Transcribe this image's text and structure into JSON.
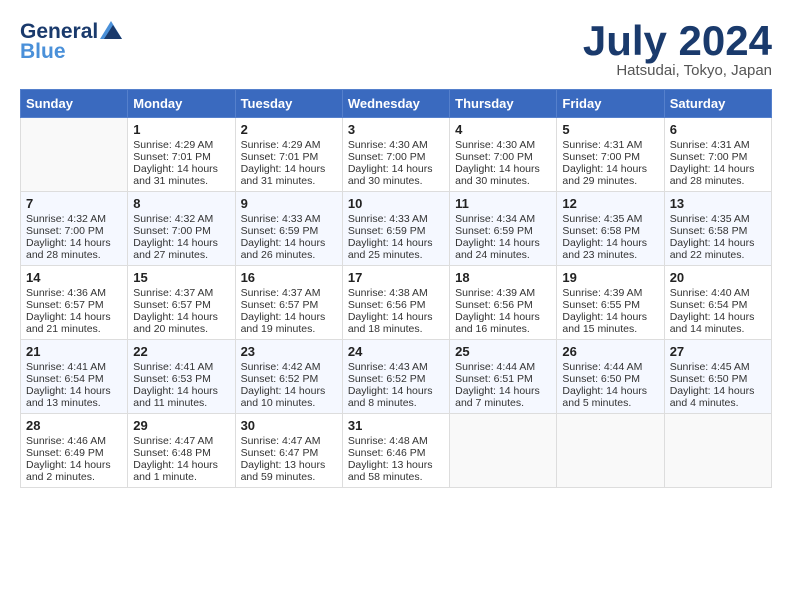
{
  "header": {
    "logo_general": "General",
    "logo_blue": "Blue",
    "month": "July 2024",
    "location": "Hatsudai, Tokyo, Japan"
  },
  "days_of_week": [
    "Sunday",
    "Monday",
    "Tuesday",
    "Wednesday",
    "Thursday",
    "Friday",
    "Saturday"
  ],
  "weeks": [
    [
      {
        "day": "",
        "sunrise": "",
        "sunset": "",
        "daylight": ""
      },
      {
        "day": "1",
        "sunrise": "Sunrise: 4:29 AM",
        "sunset": "Sunset: 7:01 PM",
        "daylight": "Daylight: 14 hours and 31 minutes."
      },
      {
        "day": "2",
        "sunrise": "Sunrise: 4:29 AM",
        "sunset": "Sunset: 7:01 PM",
        "daylight": "Daylight: 14 hours and 31 minutes."
      },
      {
        "day": "3",
        "sunrise": "Sunrise: 4:30 AM",
        "sunset": "Sunset: 7:00 PM",
        "daylight": "Daylight: 14 hours and 30 minutes."
      },
      {
        "day": "4",
        "sunrise": "Sunrise: 4:30 AM",
        "sunset": "Sunset: 7:00 PM",
        "daylight": "Daylight: 14 hours and 30 minutes."
      },
      {
        "day": "5",
        "sunrise": "Sunrise: 4:31 AM",
        "sunset": "Sunset: 7:00 PM",
        "daylight": "Daylight: 14 hours and 29 minutes."
      },
      {
        "day": "6",
        "sunrise": "Sunrise: 4:31 AM",
        "sunset": "Sunset: 7:00 PM",
        "daylight": "Daylight: 14 hours and 28 minutes."
      }
    ],
    [
      {
        "day": "7",
        "sunrise": "Sunrise: 4:32 AM",
        "sunset": "Sunset: 7:00 PM",
        "daylight": "Daylight: 14 hours and 28 minutes."
      },
      {
        "day": "8",
        "sunrise": "Sunrise: 4:32 AM",
        "sunset": "Sunset: 7:00 PM",
        "daylight": "Daylight: 14 hours and 27 minutes."
      },
      {
        "day": "9",
        "sunrise": "Sunrise: 4:33 AM",
        "sunset": "Sunset: 6:59 PM",
        "daylight": "Daylight: 14 hours and 26 minutes."
      },
      {
        "day": "10",
        "sunrise": "Sunrise: 4:33 AM",
        "sunset": "Sunset: 6:59 PM",
        "daylight": "Daylight: 14 hours and 25 minutes."
      },
      {
        "day": "11",
        "sunrise": "Sunrise: 4:34 AM",
        "sunset": "Sunset: 6:59 PM",
        "daylight": "Daylight: 14 hours and 24 minutes."
      },
      {
        "day": "12",
        "sunrise": "Sunrise: 4:35 AM",
        "sunset": "Sunset: 6:58 PM",
        "daylight": "Daylight: 14 hours and 23 minutes."
      },
      {
        "day": "13",
        "sunrise": "Sunrise: 4:35 AM",
        "sunset": "Sunset: 6:58 PM",
        "daylight": "Daylight: 14 hours and 22 minutes."
      }
    ],
    [
      {
        "day": "14",
        "sunrise": "Sunrise: 4:36 AM",
        "sunset": "Sunset: 6:57 PM",
        "daylight": "Daylight: 14 hours and 21 minutes."
      },
      {
        "day": "15",
        "sunrise": "Sunrise: 4:37 AM",
        "sunset": "Sunset: 6:57 PM",
        "daylight": "Daylight: 14 hours and 20 minutes."
      },
      {
        "day": "16",
        "sunrise": "Sunrise: 4:37 AM",
        "sunset": "Sunset: 6:57 PM",
        "daylight": "Daylight: 14 hours and 19 minutes."
      },
      {
        "day": "17",
        "sunrise": "Sunrise: 4:38 AM",
        "sunset": "Sunset: 6:56 PM",
        "daylight": "Daylight: 14 hours and 18 minutes."
      },
      {
        "day": "18",
        "sunrise": "Sunrise: 4:39 AM",
        "sunset": "Sunset: 6:56 PM",
        "daylight": "Daylight: 14 hours and 16 minutes."
      },
      {
        "day": "19",
        "sunrise": "Sunrise: 4:39 AM",
        "sunset": "Sunset: 6:55 PM",
        "daylight": "Daylight: 14 hours and 15 minutes."
      },
      {
        "day": "20",
        "sunrise": "Sunrise: 4:40 AM",
        "sunset": "Sunset: 6:54 PM",
        "daylight": "Daylight: 14 hours and 14 minutes."
      }
    ],
    [
      {
        "day": "21",
        "sunrise": "Sunrise: 4:41 AM",
        "sunset": "Sunset: 6:54 PM",
        "daylight": "Daylight: 14 hours and 13 minutes."
      },
      {
        "day": "22",
        "sunrise": "Sunrise: 4:41 AM",
        "sunset": "Sunset: 6:53 PM",
        "daylight": "Daylight: 14 hours and 11 minutes."
      },
      {
        "day": "23",
        "sunrise": "Sunrise: 4:42 AM",
        "sunset": "Sunset: 6:52 PM",
        "daylight": "Daylight: 14 hours and 10 minutes."
      },
      {
        "day": "24",
        "sunrise": "Sunrise: 4:43 AM",
        "sunset": "Sunset: 6:52 PM",
        "daylight": "Daylight: 14 hours and 8 minutes."
      },
      {
        "day": "25",
        "sunrise": "Sunrise: 4:44 AM",
        "sunset": "Sunset: 6:51 PM",
        "daylight": "Daylight: 14 hours and 7 minutes."
      },
      {
        "day": "26",
        "sunrise": "Sunrise: 4:44 AM",
        "sunset": "Sunset: 6:50 PM",
        "daylight": "Daylight: 14 hours and 5 minutes."
      },
      {
        "day": "27",
        "sunrise": "Sunrise: 4:45 AM",
        "sunset": "Sunset: 6:50 PM",
        "daylight": "Daylight: 14 hours and 4 minutes."
      }
    ],
    [
      {
        "day": "28",
        "sunrise": "Sunrise: 4:46 AM",
        "sunset": "Sunset: 6:49 PM",
        "daylight": "Daylight: 14 hours and 2 minutes."
      },
      {
        "day": "29",
        "sunrise": "Sunrise: 4:47 AM",
        "sunset": "Sunset: 6:48 PM",
        "daylight": "Daylight: 14 hours and 1 minute."
      },
      {
        "day": "30",
        "sunrise": "Sunrise: 4:47 AM",
        "sunset": "Sunset: 6:47 PM",
        "daylight": "Daylight: 13 hours and 59 minutes."
      },
      {
        "day": "31",
        "sunrise": "Sunrise: 4:48 AM",
        "sunset": "Sunset: 6:46 PM",
        "daylight": "Daylight: 13 hours and 58 minutes."
      },
      {
        "day": "",
        "sunrise": "",
        "sunset": "",
        "daylight": ""
      },
      {
        "day": "",
        "sunrise": "",
        "sunset": "",
        "daylight": ""
      },
      {
        "day": "",
        "sunrise": "",
        "sunset": "",
        "daylight": ""
      }
    ]
  ]
}
